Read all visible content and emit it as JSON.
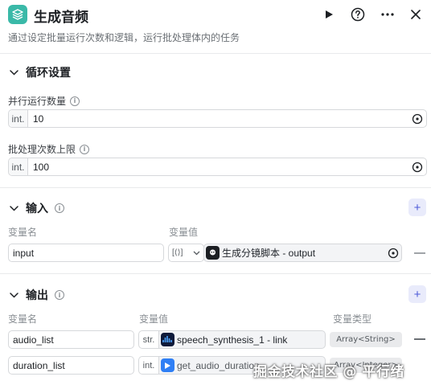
{
  "header": {
    "title": "生成音频",
    "description": "通过设定批量运行次数和逻辑，运行批处理体内的任务",
    "icons": [
      "layers-icon",
      "play-icon",
      "help-icon",
      "more-icon",
      "close-icon"
    ]
  },
  "loop_settings": {
    "title": "循环设置",
    "concurrency": {
      "label": "并行运行数量",
      "prefix": "int.",
      "value": "10"
    },
    "max_batch": {
      "label": "批处理次数上限",
      "prefix": "int.",
      "value": "100"
    }
  },
  "input_section": {
    "title": "输入",
    "col_name": "变量名",
    "col_value": "变量值",
    "rows": [
      {
        "name": "input",
        "type_prefix": "[⟨⟩]",
        "ref_text": "生成分镜脚本 - output"
      }
    ]
  },
  "output_section": {
    "title": "输出",
    "col_name": "变量名",
    "col_value": "变量值",
    "col_type": "变量类型",
    "rows": [
      {
        "name": "audio_list",
        "type_prefix": "str.",
        "ref_text": "speech_synthesis_1 - link",
        "var_type": "Array<String>"
      },
      {
        "name": "duration_list",
        "type_prefix": "int.",
        "ref_text": "get_audio_duration",
        "var_type": "Array<Integer>"
      }
    ]
  },
  "watermark": "掘金技术社区 @ 平行绪",
  "colors": {
    "accent": "#4e5bd8",
    "node_icon_bg": "#3ab9a8",
    "plus_bg": "#e9ebfb"
  }
}
